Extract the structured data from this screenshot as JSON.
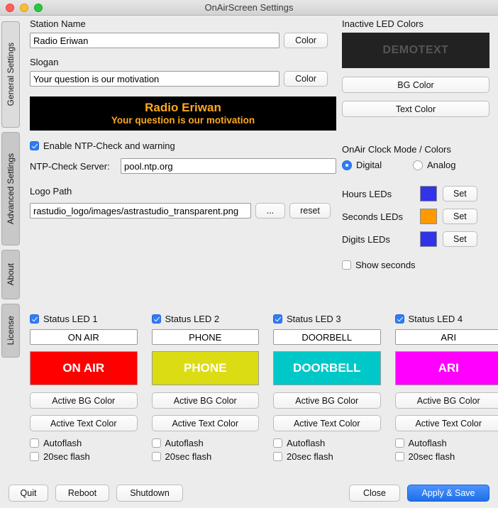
{
  "window": {
    "title": "OnAirScreen Settings",
    "traffic_lights": [
      "close-button",
      "minimize-button",
      "zoom-button"
    ]
  },
  "sidebar": {
    "items": [
      {
        "label": "General Settings",
        "selected": true
      },
      {
        "label": "Advanced Settings",
        "selected": false
      },
      {
        "label": "About",
        "selected": false
      },
      {
        "label": "License",
        "selected": false
      }
    ]
  },
  "general": {
    "station_name_label": "Station Name",
    "station_name_value": "Radio Eriwan",
    "station_color_button": "Color",
    "slogan_label": "Slogan",
    "slogan_value": "Your question is our motivation",
    "slogan_color_button": "Color",
    "preview": {
      "title": "Radio Eriwan",
      "slogan": "Your question is our motivation",
      "bg_color": "#000000",
      "text_color": "#FFA81E"
    },
    "ntp_checkbox_label": "Enable NTP-Check and warning",
    "ntp_checkbox_checked": true,
    "ntp_server_label": "NTP-Check Server:",
    "ntp_server_value": "pool.ntp.org",
    "logo_path_label": "Logo Path",
    "logo_path_value": "rastudio_logo/images/astrastudio_transparent.png",
    "logo_browse_button": "...",
    "logo_reset_button": "reset"
  },
  "inactive_led": {
    "title": "Inactive LED Colors",
    "demo_text": "DEMOTEXT",
    "demo_bg_color": "#222222",
    "demo_text_color": "#555555",
    "bg_color_button": "BG Color",
    "text_color_button": "Text Color"
  },
  "clock": {
    "title": "OnAir Clock Mode / Colors",
    "mode_digital_label": "Digital",
    "mode_analog_label": "Analog",
    "mode_selected": "Digital",
    "rows": [
      {
        "label": "Hours LEDs",
        "color": "#3232e6",
        "button": "Set"
      },
      {
        "label": "Seconds LEDs",
        "color": "#ff9900",
        "button": "Set"
      },
      {
        "label": "Digits LEDs",
        "color": "#3232e6",
        "button": "Set"
      }
    ],
    "show_seconds_label": "Show seconds",
    "show_seconds_checked": false
  },
  "status_leds": [
    {
      "enable_label": "Status LED 1",
      "enabled": true,
      "name_value": "ON AIR",
      "preview_text": "ON AIR",
      "preview_bg": "#FF0000",
      "preview_fg": "#FFFFFF",
      "bg_color_button": "Active BG Color",
      "text_color_button": "Active Text Color",
      "autoflash_label": "Autoflash",
      "autoflash_checked": false,
      "flash20_label": "20sec flash",
      "flash20_checked": false
    },
    {
      "enable_label": "Status LED 2",
      "enabled": true,
      "name_value": "PHONE",
      "preview_text": "PHONE",
      "preview_bg": "#DCDC14",
      "preview_fg": "#FFFFFF",
      "bg_color_button": "Active BG Color",
      "text_color_button": "Active Text Color",
      "autoflash_label": "Autoflash",
      "autoflash_checked": false,
      "flash20_label": "20sec flash",
      "flash20_checked": false
    },
    {
      "enable_label": "Status LED 3",
      "enabled": true,
      "name_value": "DOORBELL",
      "preview_text": "DOORBELL",
      "preview_bg": "#00C8C8",
      "preview_fg": "#FFFFFF",
      "bg_color_button": "Active BG Color",
      "text_color_button": "Active Text Color",
      "autoflash_label": "Autoflash",
      "autoflash_checked": false,
      "flash20_label": "20sec flash",
      "flash20_checked": false
    },
    {
      "enable_label": "Status LED 4",
      "enabled": true,
      "name_value": "ARI",
      "preview_text": "ARI",
      "preview_bg": "#FF00FF",
      "preview_fg": "#FFFFFF",
      "bg_color_button": "Active BG Color",
      "text_color_button": "Active Text Color",
      "autoflash_label": "Autoflash",
      "autoflash_checked": false,
      "flash20_label": "20sec flash",
      "flash20_checked": false
    }
  ],
  "footer": {
    "quit_button": "Quit",
    "reboot_button": "Reboot",
    "shutdown_button": "Shutdown",
    "close_button": "Close",
    "apply_button": "Apply & Save",
    "apply_accent_color": "#1f6fe8"
  }
}
